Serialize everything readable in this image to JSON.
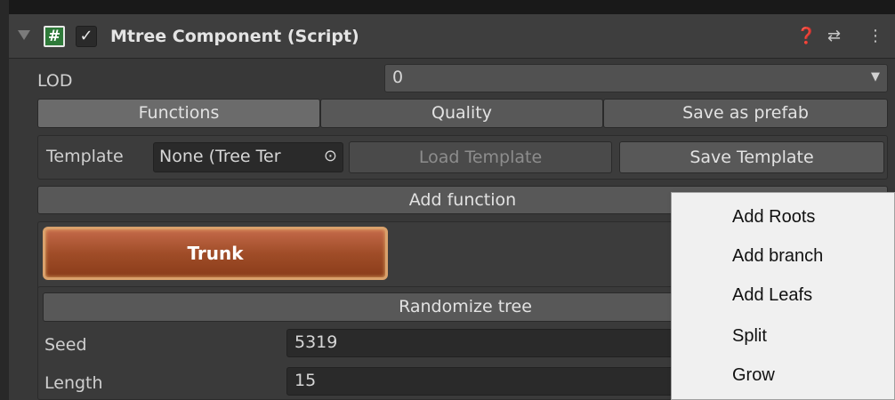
{
  "header": {
    "title": "Mtree Component (Script)",
    "script_icon_glyph": "#",
    "checkbox_glyph": "✓",
    "help_glyph": "❓",
    "settings_glyph": "⇄",
    "more_glyph": "⋮"
  },
  "lod": {
    "label": "LOD",
    "value": "0",
    "dropdown_glyph": "▼"
  },
  "tabs": [
    {
      "label": "Functions",
      "active": true
    },
    {
      "label": "Quality",
      "active": false
    },
    {
      "label": "Save as prefab",
      "active": false
    }
  ],
  "template": {
    "label": "Template",
    "value": "None (Tree Ter",
    "picker_glyph": "⊙",
    "load_label": "Load Template",
    "save_label": "Save Template"
  },
  "add_function_label": "Add function",
  "trunk_label": "Trunk",
  "randomize_label": "Randomize tree",
  "fields": [
    {
      "label": "Seed",
      "value": "5319"
    },
    {
      "label": "Length",
      "value": "15"
    }
  ],
  "context_menu": {
    "items": [
      "Add Roots",
      "Add branch",
      "Add Leafs",
      "Split",
      "Grow"
    ]
  }
}
